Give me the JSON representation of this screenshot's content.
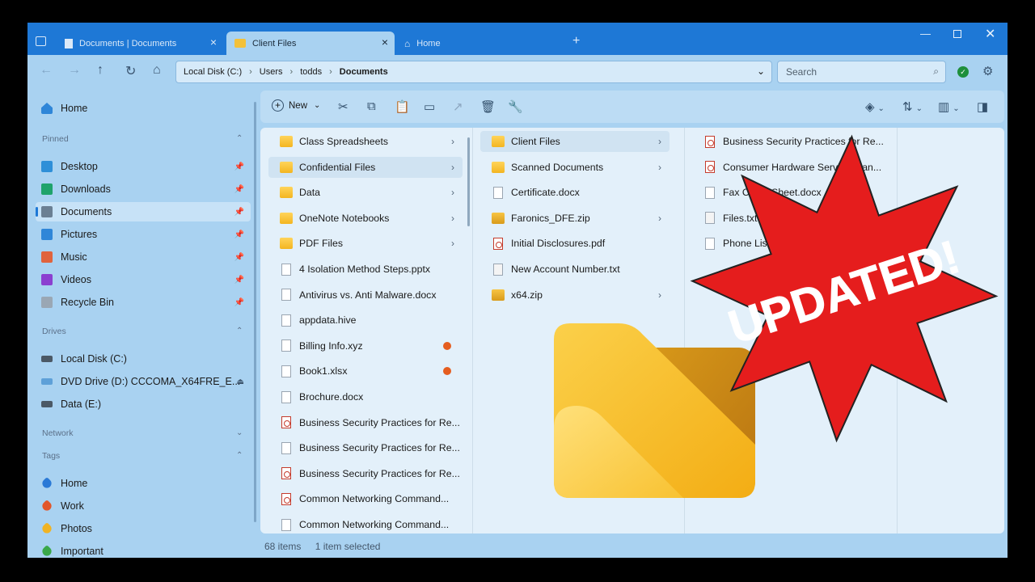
{
  "tabs": [
    {
      "label": "Documents | Documents",
      "active": false
    },
    {
      "label": "Client Files",
      "active": true
    },
    {
      "label": "Home",
      "active": false
    }
  ],
  "window_controls": [
    "minimize",
    "maximize",
    "close"
  ],
  "nav": {
    "breadcrumb": [
      "Local Disk (C:)",
      "Users",
      "todds",
      "Documents"
    ],
    "search_placeholder": "Search"
  },
  "sidebar": {
    "home": "Home",
    "pinned_header": "Pinned",
    "pinned": [
      {
        "label": "Desktop",
        "icon": "desktop-icon",
        "color": "#2e8fd8"
      },
      {
        "label": "Downloads",
        "icon": "download-icon",
        "color": "#1fa36b"
      },
      {
        "label": "Documents",
        "icon": "documents-icon",
        "color": "#6b7f93",
        "selected": true
      },
      {
        "label": "Pictures",
        "icon": "pictures-icon",
        "color": "#2f86d8"
      },
      {
        "label": "Music",
        "icon": "music-icon",
        "color": "#e0633d"
      },
      {
        "label": "Videos",
        "icon": "videos-icon",
        "color": "#8b3fd0"
      },
      {
        "label": "Recycle Bin",
        "icon": "recycle-bin-icon",
        "color": "#9aa7b4"
      }
    ],
    "drives_header": "Drives",
    "drives": [
      {
        "label": "Local Disk (C:)",
        "icon": "drive-icon",
        "color": "#4b5966"
      },
      {
        "label": "DVD Drive (D:) CCCOMA_X64FRE_E...",
        "icon": "dvd-icon",
        "color": "#5ea0d8",
        "eject": true
      },
      {
        "label": "Data (E:)",
        "icon": "drive-icon",
        "color": "#4b5966"
      }
    ],
    "network_header": "Network",
    "tags_header": "Tags",
    "tags": [
      {
        "label": "Home",
        "color": "#2a79d6"
      },
      {
        "label": "Work",
        "color": "#e2562a"
      },
      {
        "label": "Photos",
        "color": "#f0b323"
      },
      {
        "label": "Important",
        "color": "#3aa84a"
      }
    ]
  },
  "toolbar": {
    "new_label": "New"
  },
  "columns": {
    "documents": [
      {
        "name": "Class Spreadsheets",
        "type": "folder",
        "arrow": true
      },
      {
        "name": "Confidential Files",
        "type": "folder",
        "arrow": true,
        "selected": true
      },
      {
        "name": "Data",
        "type": "folder",
        "arrow": true
      },
      {
        "name": "OneNote Notebooks",
        "type": "folder",
        "arrow": true
      },
      {
        "name": "PDF Files",
        "type": "folder",
        "arrow": true
      },
      {
        "name": "4 Isolation Method Steps.pptx",
        "type": "doc"
      },
      {
        "name": "Antivirus vs. Anti Malware.docx",
        "type": "doc"
      },
      {
        "name": "appdata.hive",
        "type": "doc"
      },
      {
        "name": "Billing Info.xyz",
        "type": "doc",
        "tag": "#e55d1f"
      },
      {
        "name": "Book1.xlsx",
        "type": "doc",
        "tag": "#e55d1f"
      },
      {
        "name": "Brochure.docx",
        "type": "doc"
      },
      {
        "name": "Business Security Practices for Re...",
        "type": "pdf"
      },
      {
        "name": "Business Security Practices for Re...",
        "type": "doc"
      },
      {
        "name": "Business Security Practices for Re...",
        "type": "pdf"
      },
      {
        "name": "Common Networking Command...",
        "type": "pdf"
      },
      {
        "name": "Common Networking Command...",
        "type": "doc"
      }
    ],
    "confidential": [
      {
        "name": "Client Files",
        "type": "folder",
        "arrow": true,
        "selected": true
      },
      {
        "name": "Scanned Documents",
        "type": "folder",
        "arrow": true
      },
      {
        "name": "Certificate.docx",
        "type": "doc"
      },
      {
        "name": "Faronics_DFE.zip",
        "type": "zip",
        "arrow": true
      },
      {
        "name": "Initial Disclosures.pdf",
        "type": "pdf"
      },
      {
        "name": "New Account Number.txt",
        "type": "txt"
      },
      {
        "name": "x64.zip",
        "type": "zip",
        "arrow": true
      }
    ],
    "client_files": [
      {
        "name": "Business Security Practices for Re...",
        "type": "pdf"
      },
      {
        "name": "Consumer Hardware Service Plan...",
        "type": "pdf"
      },
      {
        "name": "Fax Cover Sheet.docx",
        "type": "doc"
      },
      {
        "name": "Files.txt",
        "type": "txt"
      },
      {
        "name": "Phone List",
        "type": "doc"
      }
    ]
  },
  "status": {
    "items": "68 items",
    "selected": "1 item selected"
  },
  "overlay": {
    "burst_text": "UPDATED!",
    "burst_color": "#e51d1d"
  }
}
